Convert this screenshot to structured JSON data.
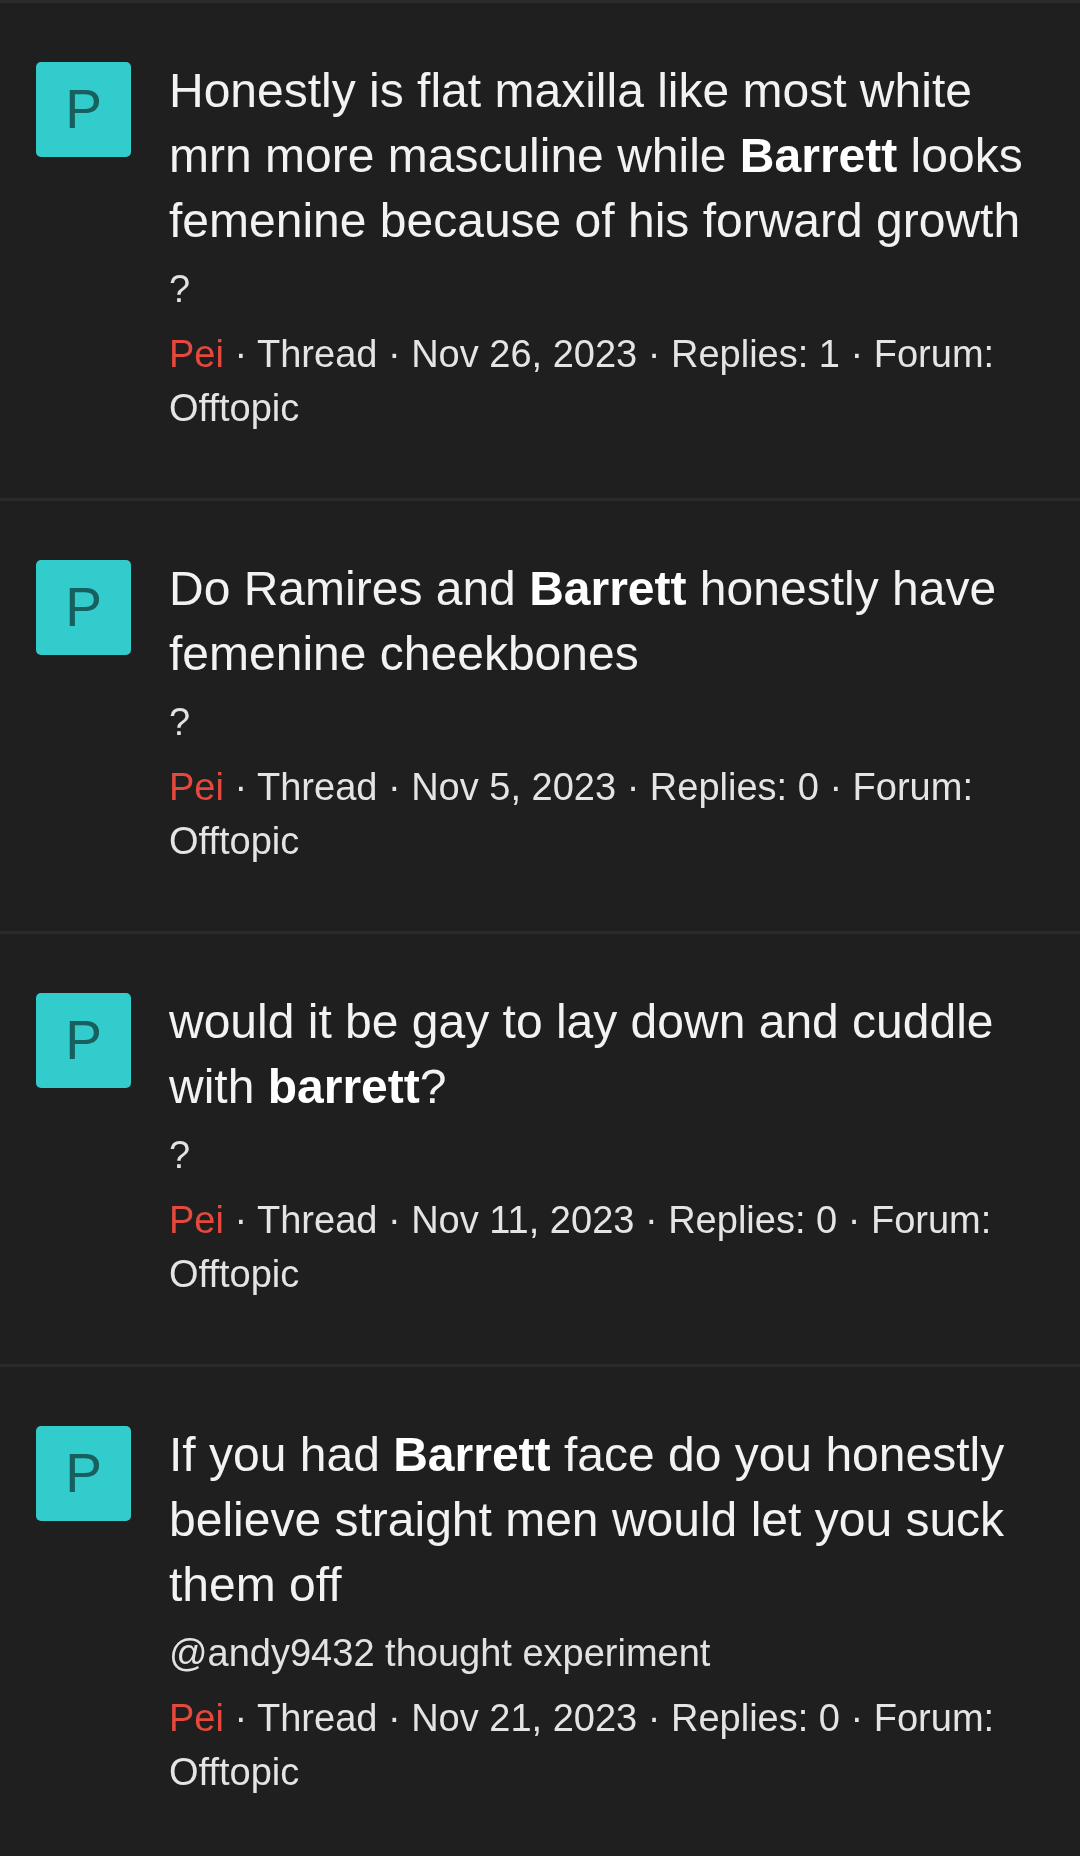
{
  "results": [
    {
      "avatar_letter": "P",
      "title": "Honestly is flat maxilla like most white mrn more masculine while **Barrett** looks femenine because of his forward growth",
      "snippet": "?",
      "author": "Pei",
      "meta": "· Thread · Nov 26, 2023 · Replies: 1 · Forum: Offtopic"
    },
    {
      "avatar_letter": "P",
      "title": "Do Ramires and **Barrett** honestly have femenine cheekbones",
      "snippet": "?",
      "author": "Pei",
      "meta": "· Thread · Nov 5, 2023 · Replies: 0 · Forum: Offtopic"
    },
    {
      "avatar_letter": "P",
      "title": "would it be gay to lay down and cuddle with **barrett**?",
      "snippet": "?",
      "author": "Pei",
      "meta": "· Thread · Nov 11, 2023 · Replies: 0 · Forum: Offtopic"
    },
    {
      "avatar_letter": "P",
      "title": "If you had **Barrett** face do you honestly believe straight men would let you suck them off",
      "snippet": "@andy9432 thought experiment",
      "author": "Pei",
      "meta": "· Thread · Nov 21, 2023 · Replies: 0 · Forum: Offtopic"
    }
  ]
}
